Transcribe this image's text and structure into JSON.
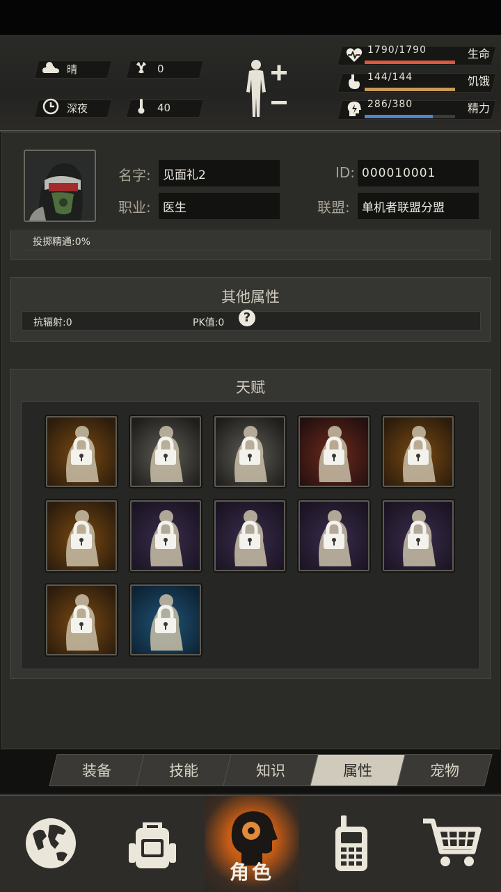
{
  "hud": {
    "weather": {
      "icon": "cloud-sun-icon",
      "label": "晴"
    },
    "radiation": {
      "icon": "radiation-icon",
      "value": "0"
    },
    "time": {
      "icon": "clock-icon",
      "label": "深夜"
    },
    "temperature": {
      "icon": "thermometer-icon",
      "value": "40"
    },
    "bars": [
      {
        "icon": "heart-pulse-icon",
        "text": "1790/1790",
        "label": "生命",
        "fill": 1.0,
        "color": "#d9583f"
      },
      {
        "icon": "stomach-icon",
        "text": "144/144",
        "label": "饥饿",
        "fill": 1.0,
        "color": "#c79a55"
      },
      {
        "icon": "brain-icon",
        "text": "286/380",
        "label": "精力",
        "fill": 0.75,
        "color": "#4f86c6"
      }
    ]
  },
  "profile": {
    "name_label": "名字:",
    "name_value": "见面礼2",
    "id_label": "ID:",
    "id_value": "000010001",
    "job_label": "职业:",
    "job_value": "医生",
    "alliance_label": "联盟:",
    "alliance_value": "单机者联盟分盟"
  },
  "throwing_mastery": "投掷精通:0%",
  "other_attributes": {
    "title": "其他属性",
    "anti_radiation": "抗辐射:0",
    "pk_value": "PK值:0"
  },
  "talents": {
    "title": "天赋",
    "items": [
      {
        "icon": "porter-icon",
        "bg": "orange",
        "locked": true
      },
      {
        "icon": "panda-icon",
        "bg": "gray",
        "locked": true
      },
      {
        "icon": "brawler-icon",
        "bg": "gray",
        "locked": true
      },
      {
        "icon": "fist-icon",
        "bg": "red",
        "locked": true
      },
      {
        "icon": "strongman-icon",
        "bg": "orange",
        "locked": true
      },
      {
        "icon": "boxer-icon",
        "bg": "orange",
        "locked": true
      },
      {
        "icon": "pistol-icon",
        "bg": "purple",
        "locked": true
      },
      {
        "icon": "rifleman-icon",
        "bg": "purple",
        "locked": true
      },
      {
        "icon": "archer-icon",
        "bg": "purple",
        "locked": true
      },
      {
        "icon": "shield-icon",
        "bg": "purple",
        "locked": true
      },
      {
        "icon": "dodge-icon",
        "bg": "orange",
        "locked": true
      },
      {
        "icon": "crouch-icon",
        "bg": "blue",
        "locked": true
      }
    ]
  },
  "tabs": [
    {
      "label": "装备",
      "active": false
    },
    {
      "label": "技能",
      "active": false
    },
    {
      "label": "知识",
      "active": false
    },
    {
      "label": "属性",
      "active": true
    },
    {
      "label": "宠物",
      "active": false
    }
  ],
  "nav": {
    "world": "globe-icon",
    "bag": "backpack-icon",
    "character_label": "角色",
    "radio": "walkie-talkie-icon",
    "shop": "shopping-cart-icon"
  }
}
